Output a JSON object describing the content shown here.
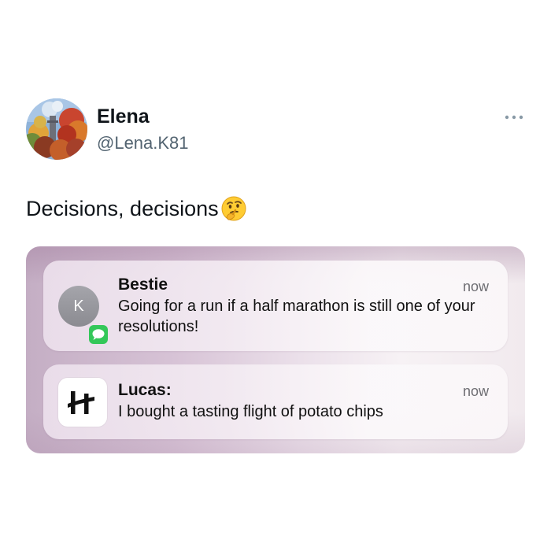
{
  "post": {
    "author": {
      "name": "Elena",
      "handle": "@Lena.K81"
    },
    "text": "Decisions, decisions",
    "emoji_icon": "thinking-face-emoji",
    "more_icon": "more-horizontal-icon"
  },
  "screenshot": {
    "notifications": [
      {
        "sender": "Bestie",
        "time": "now",
        "message": "Going for a run if a half marathon is still one of your resolutions!",
        "avatar_letter": "K",
        "badge_icon": "messages-app-icon"
      },
      {
        "sender": "Lucas:",
        "time": "now",
        "message": "I bought a tasting flight of potato chips",
        "app_icon": "hinge-app-icon"
      }
    ]
  },
  "colors": {
    "text_primary": "#0f1419",
    "text_secondary": "#536471",
    "messages_green": "#34c759"
  }
}
